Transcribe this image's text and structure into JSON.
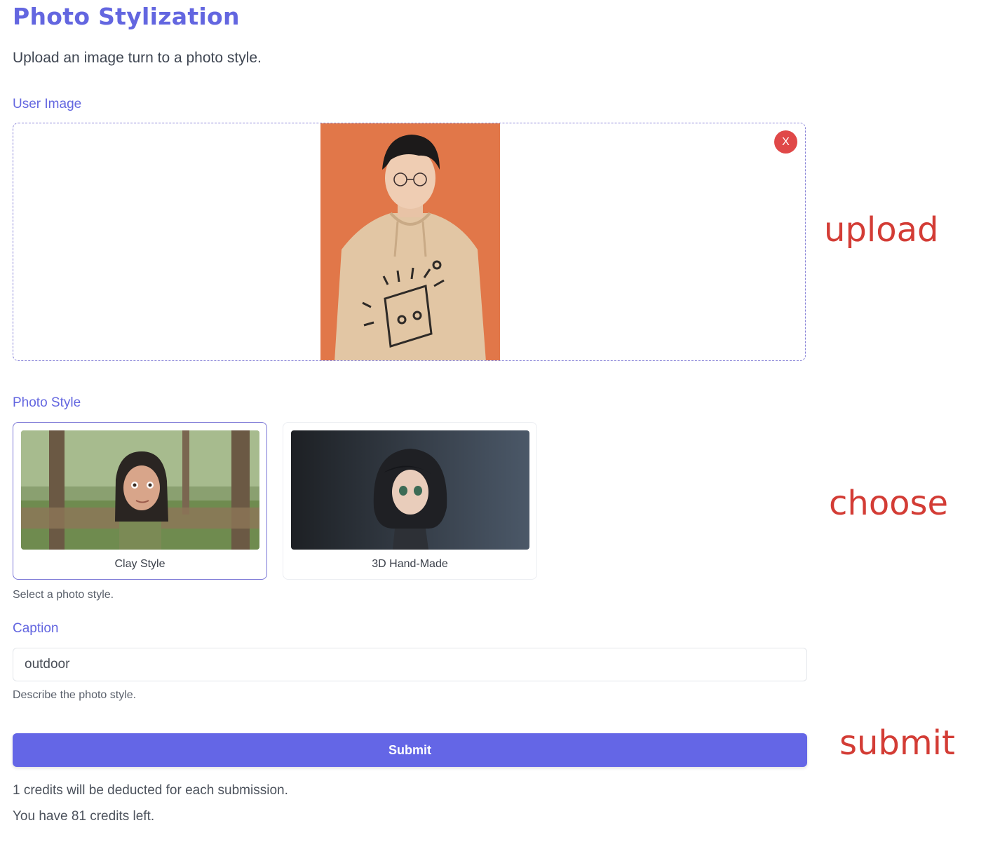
{
  "page": {
    "title": "Photo Stylization",
    "subtitle": "Upload an image turn to a photo style."
  },
  "user_image": {
    "label": "User Image",
    "remove_label": "X"
  },
  "photo_style": {
    "label": "Photo Style",
    "options": [
      {
        "label": "Clay Style",
        "selected": true
      },
      {
        "label": "3D Hand-Made",
        "selected": false
      }
    ],
    "help": "Select a photo style."
  },
  "caption": {
    "label": "Caption",
    "value": "outdoor",
    "help": "Describe the photo style."
  },
  "submit": {
    "label": "Submit"
  },
  "credits": {
    "deduct_text": "1 credits will be deducted for each submission.",
    "remaining_text": "You have 81 credits left."
  },
  "annotations": {
    "upload": "upload",
    "choose": "choose",
    "submit": "submit"
  },
  "colors": {
    "accent": "#6366e0",
    "button": "#6466e6",
    "annotation": "#d33c35",
    "remove": "#e04848"
  }
}
